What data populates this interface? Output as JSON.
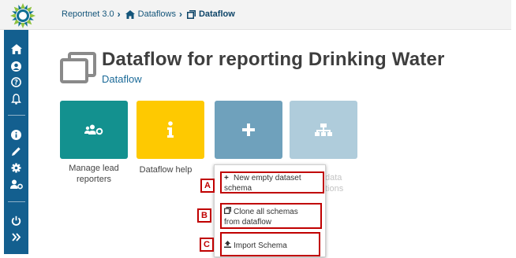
{
  "breadcrumb": {
    "items": [
      "Reportnet 3.0",
      "Dataflows",
      "Dataflow"
    ]
  },
  "sidebar": {
    "icons": [
      "home-icon",
      "user-icon",
      "help-icon",
      "bell-icon",
      "info-icon",
      "pencil-icon",
      "gear-icon",
      "user-settings-icon",
      "power-icon",
      "expand-icon"
    ]
  },
  "header": {
    "title": "Dataflow for reporting Drinking Water",
    "subtitle": "Dataflow"
  },
  "tiles": [
    {
      "label": "Manage lead reporters",
      "color": "#13918f"
    },
    {
      "label": "Dataflow help",
      "color": "#fec901"
    },
    {
      "label": "",
      "color": "#6fa1bc"
    },
    {
      "label": "data tions",
      "color": "#afccdb"
    }
  ],
  "menu": {
    "items": [
      {
        "label_line1": "New empty dataset",
        "label_line2": "schema",
        "tag": "A"
      },
      {
        "label_line1": "Clone all schemas",
        "label_line2": "from dataflow",
        "tag": "B"
      },
      {
        "label_line1": "Import Schema",
        "label_line2": "",
        "tag": "C"
      }
    ]
  },
  "colors": {
    "sidebar": "#135f8f",
    "callout": "#c00000",
    "link": "#14557a"
  }
}
